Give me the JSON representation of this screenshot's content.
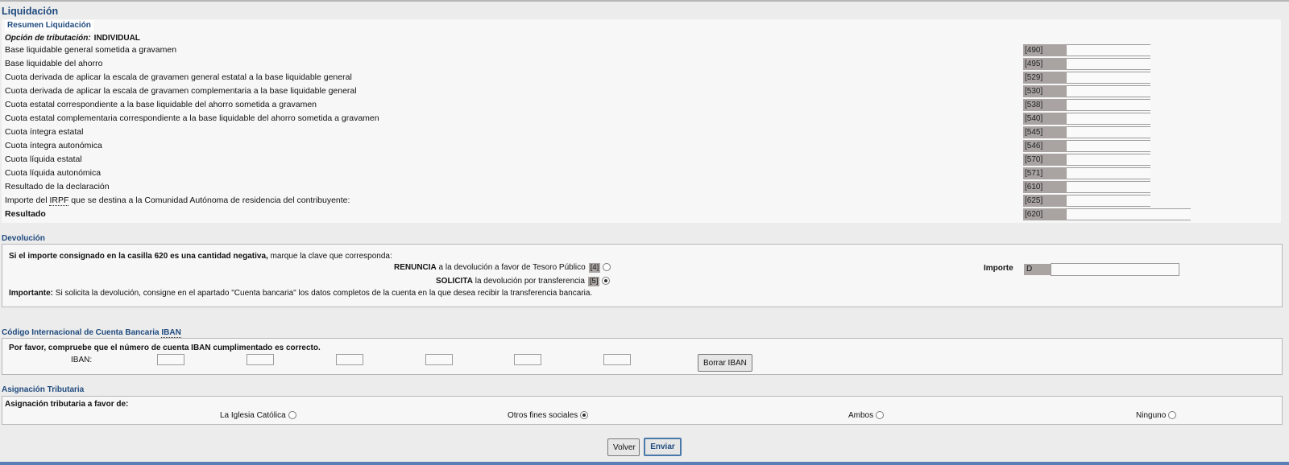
{
  "page_title": "Liquidación",
  "resumen": {
    "tab_label": "Resumen Liquidación",
    "opcion_label": "Opción de tributación:",
    "opcion_value": "INDIVIDUAL",
    "rows": [
      {
        "label": "Base liquidable general sometida a gravamen",
        "code": "[490]",
        "value": ""
      },
      {
        "label": "Base liquidable del ahorro",
        "code": "[495]",
        "value": ""
      },
      {
        "label": "Cuota derivada de aplicar la escala de gravamen general estatal a la base liquidable general",
        "code": "[529]",
        "value": ""
      },
      {
        "label": "Cuota derivada de aplicar la escala de gravamen complementaria a la base liquidable general",
        "code": "[530]",
        "value": ""
      },
      {
        "label": "Cuota estatal correspondiente a la base liquidable del ahorro sometida a gravamen",
        "code": "[538]",
        "value": ""
      },
      {
        "label": "Cuota estatal complementaria correspondiente a la base liquidable del ahorro sometida a gravamen",
        "code": "[540]",
        "value": ""
      },
      {
        "label": "Cuota íntegra estatal",
        "code": "[545]",
        "value": ""
      },
      {
        "label": "Cuota íntegra autonómica",
        "code": "[546]",
        "value": ""
      },
      {
        "label": "Cuota líquida estatal",
        "code": "[570]",
        "value": ""
      },
      {
        "label": "Cuota líquida autonómica",
        "code": "[571]",
        "value": ""
      },
      {
        "label": "Resultado de la declaración",
        "code": "[610]",
        "value": ""
      },
      {
        "label_pre": "Importe del ",
        "label_abbr": "IRPF",
        "label_post": " que se destina a la Comunidad Autónoma de residencia del contribuyente:",
        "code": "[625]",
        "value": ""
      },
      {
        "label": "Resultado",
        "code": "[620]",
        "value": ""
      }
    ]
  },
  "devolucion": {
    "title": "Devolución",
    "intro_bold": "Si el importe consignado en la casilla 620 es una cantidad negativa,",
    "intro_rest": " marque la clave que corresponda:",
    "renuncia_bold": "RENUNCIA",
    "renuncia_rest": " a la devolución a favor de Tesoro Público",
    "renuncia_code": "[4]",
    "solicita_bold": "SOLICITA",
    "solicita_rest": " la devolución por transferencia",
    "solicita_code": "[5]",
    "importante_bold": "Importante:",
    "importante_rest": " Si solicita la devolución, consigne en el apartado \"Cuenta bancaria\" los datos completos de la cuenta en la que desea recibir la transferencia bancaria.",
    "importe_label": "Importe",
    "importe_code": "D",
    "importe_value": ""
  },
  "iban": {
    "title_pre": "Código Internacional de Cuenta Bancaria ",
    "title_abbr": "IBAN",
    "notice": "Por favor, compruebe que el número de cuenta IBAN cumplimentado es correcto.",
    "label": "IBAN:",
    "fields": [
      "",
      "",
      "",
      "",
      "",
      ""
    ],
    "clear_button": "Borrar IBAN"
  },
  "asignacion": {
    "title": "Asignación Tributaria",
    "label": "Asignación tributaria a favor de:",
    "options": [
      "La Iglesia Católica",
      "Otros fines sociales",
      "Ambos",
      "Ninguno"
    ],
    "selected": "Otros fines sociales"
  },
  "buttons": {
    "volver": "Volver",
    "enviar": "Enviar"
  },
  "colors": {
    "title_blue": "#1f4a7e",
    "code_gray": "#a9a4a2",
    "page_bg": "#ececec"
  }
}
